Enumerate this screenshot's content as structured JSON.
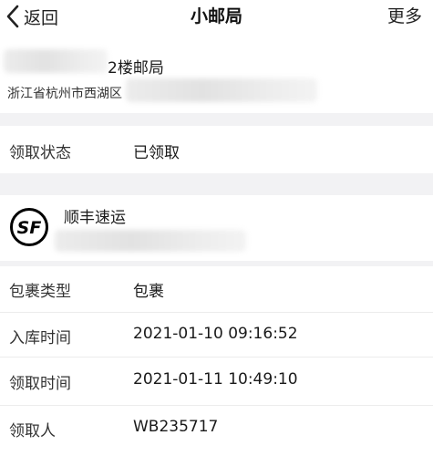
{
  "nav": {
    "back_label": "返回",
    "title": "小邮局",
    "more_label": "更多"
  },
  "station": {
    "name": "2楼邮局",
    "address": "浙江省杭州市西湖区"
  },
  "pickup_status": {
    "label": "领取状态",
    "value": "已领取"
  },
  "courier": {
    "name": "顺丰速运",
    "logo_text": "SF"
  },
  "details": [
    {
      "label": "包裹类型",
      "value": "包裹"
    },
    {
      "label": "入库时间",
      "value": "2021-01-10 09:16:52"
    },
    {
      "label": "领取时间",
      "value": "2021-01-11 10:49:10"
    },
    {
      "label": "领取人",
      "value": "WB235717"
    }
  ],
  "colors": {
    "background": "#ffffff",
    "section_gap": "#f2f2f4",
    "text_primary": "#1a1a1a",
    "text_secondary": "#333333",
    "logo": "#000000"
  },
  "icons": {
    "back": "chevron-left-icon",
    "courier_logo": "sf-express-logo"
  }
}
